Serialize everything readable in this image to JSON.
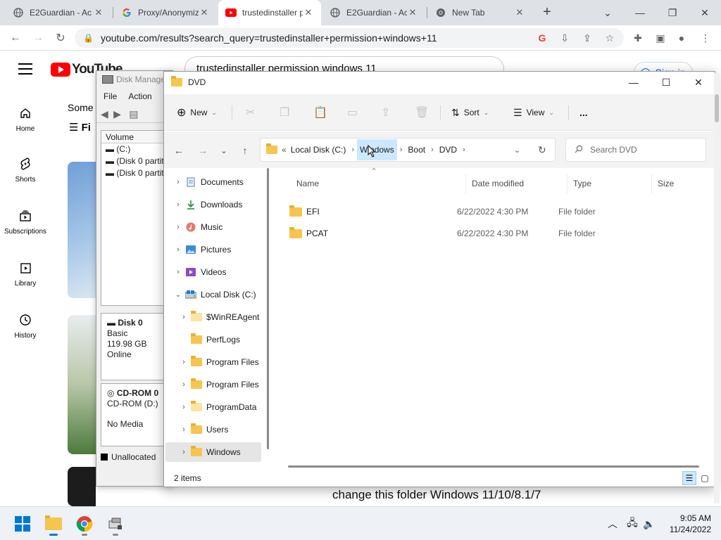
{
  "browser": {
    "tabs": [
      {
        "title": "E2Guardian - Ac",
        "icon": "globe-icon"
      },
      {
        "title": "Proxy/Anonymiz",
        "icon": "google-icon"
      },
      {
        "title": "trustedinstaller p",
        "icon": "youtube-icon",
        "active": true
      },
      {
        "title": "E2Guardian - Ac",
        "icon": "globe-icon"
      },
      {
        "title": "New Tab",
        "icon": "chrome-icon"
      }
    ],
    "url": "youtube.com/results?search_query=trustedinstaller+permission+windows+11"
  },
  "youtube": {
    "logo_text": "YouTube",
    "search_value": "trustedinstaller permission windows 11",
    "sign_in": "Sign in",
    "sidebar": [
      {
        "label": "Home",
        "icon": "home-icon"
      },
      {
        "label": "Shorts",
        "icon": "shorts-icon"
      },
      {
        "label": "Subscriptions",
        "icon": "subscriptions-icon"
      },
      {
        "label": "Library",
        "icon": "library-icon"
      },
      {
        "label": "History",
        "icon": "history-icon"
      }
    ],
    "some_text": "Some",
    "filter_text": "Fi",
    "caption": "change this folder Windows 11/10/8.1/7"
  },
  "disk_mgmt": {
    "title": "Disk Manage",
    "menu": [
      "File",
      "Action"
    ],
    "volume_header": "Volume",
    "volumes": [
      "(C:)",
      "(Disk 0 partiti",
      "(Disk 0 partiti"
    ],
    "disk0": {
      "name": "Disk 0",
      "type": "Basic",
      "size": "119.98 GB",
      "status": "Online"
    },
    "cdrom": {
      "name": "CD-ROM 0",
      "label": "CD-ROM (D:)",
      "status": "No Media"
    },
    "legend": "Unallocated"
  },
  "explorer": {
    "title": "DVD",
    "commands": {
      "new": "New",
      "sort": "Sort",
      "view": "View",
      "more": "..."
    },
    "breadcrumb": [
      "Local Disk (C:)",
      "Windows",
      "Boot",
      "DVD"
    ],
    "breadcrumb_prefix": "«",
    "search_placeholder": "Search DVD",
    "columns": [
      "Name",
      "Date modified",
      "Type",
      "Size"
    ],
    "tree": [
      {
        "label": "Documents",
        "icon": "documents-icon",
        "level": 0
      },
      {
        "label": "Downloads",
        "icon": "downloads-icon",
        "level": 0
      },
      {
        "label": "Music",
        "icon": "music-icon",
        "level": 0
      },
      {
        "label": "Pictures",
        "icon": "pictures-icon",
        "level": 0
      },
      {
        "label": "Videos",
        "icon": "videos-icon",
        "level": 0
      },
      {
        "label": "Local Disk (C:)",
        "icon": "drive-icon",
        "level": 0,
        "expanded": true
      },
      {
        "label": "$WinREAgent",
        "icon": "folder-icon",
        "level": 1
      },
      {
        "label": "PerfLogs",
        "icon": "folder-icon",
        "level": 1
      },
      {
        "label": "Program Files",
        "icon": "folder-icon",
        "level": 1
      },
      {
        "label": "Program Files",
        "icon": "folder-icon",
        "level": 1
      },
      {
        "label": "ProgramData",
        "icon": "folder-icon",
        "level": 1
      },
      {
        "label": "Users",
        "icon": "folder-icon",
        "level": 1
      },
      {
        "label": "Windows",
        "icon": "folder-icon",
        "level": 1,
        "selected": true
      }
    ],
    "files": [
      {
        "name": "EFI",
        "date": "6/22/2022 4:30 PM",
        "type": "File folder",
        "size": ""
      },
      {
        "name": "PCAT",
        "date": "6/22/2022 4:30 PM",
        "type": "File folder",
        "size": ""
      }
    ],
    "status": "2 items"
  },
  "taskbar": {
    "time": "9:05 AM",
    "date": "11/24/2022"
  },
  "colors": {
    "youtube_red": "#ff0000",
    "folder_yellow": "#f6c550",
    "selection_blue": "#cce8ff",
    "chrome_tabstrip": "#dee1e6"
  }
}
